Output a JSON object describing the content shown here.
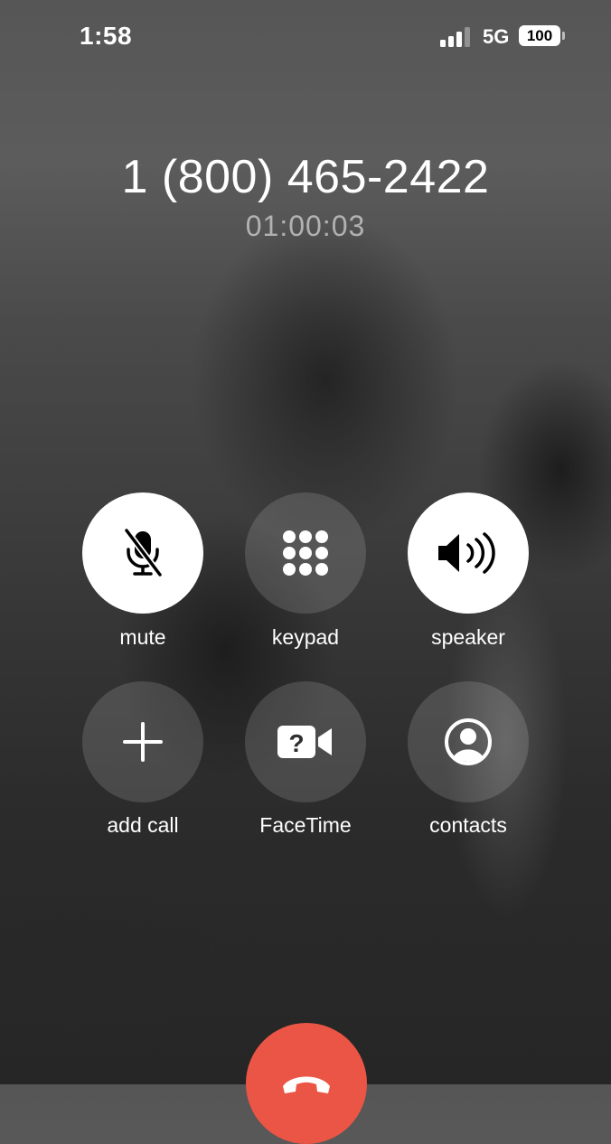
{
  "status_bar": {
    "time": "1:58",
    "network": "5G",
    "battery": "100",
    "signal_bars_filled": 3,
    "signal_bars_total": 4
  },
  "call": {
    "number": "1 (800) 465-2422",
    "duration": "01:00:03"
  },
  "controls": {
    "mute": "mute",
    "keypad": "keypad",
    "speaker": "speaker",
    "add_call": "add call",
    "facetime": "FaceTime",
    "contacts": "contacts"
  },
  "colors": {
    "end_call": "#eb5545",
    "active_button": "#ffffff"
  }
}
